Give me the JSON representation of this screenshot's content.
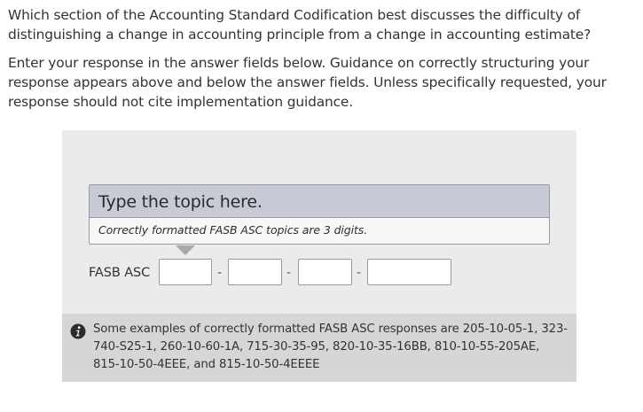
{
  "question": {
    "text": "Which section of the Accounting Standard Codification best discusses the difficulty of distinguishing a change in accounting principle from a change in accounting estimate?"
  },
  "instructions": {
    "text": "Enter your response in the answer fields below. Guidance on correctly structuring your response appears above and below the answer fields. Unless specifically requested, your response should not cite implementation guidance."
  },
  "answer_panel": {
    "hint_title": "Type the topic here.",
    "hint_subtitle": "Correctly formatted FASB ASC topics are 3 digits.",
    "asc_label": "FASB ASC",
    "separator": "-",
    "fields": [
      {
        "name": "topic",
        "value": ""
      },
      {
        "name": "subtopic",
        "value": ""
      },
      {
        "name": "section",
        "value": ""
      },
      {
        "name": "paragraph",
        "value": ""
      }
    ],
    "examples_text": "Some examples of correctly formatted FASB ASC responses are 205-10-05-1, 323-740-S25-1, 260-10-60-1A, 715-30-35-95, 820-10-35-16BB, 810-10-55-205AE, 815-10-50-4EEE, and 815-10-50-4EEEE",
    "info_icon": "info-icon"
  },
  "colors": {
    "panel_bg": "#ebebeb",
    "hint_title_bg": "#c8cad6",
    "examples_bg": "#d6d6d6",
    "info_icon": "#2b2b2b"
  }
}
